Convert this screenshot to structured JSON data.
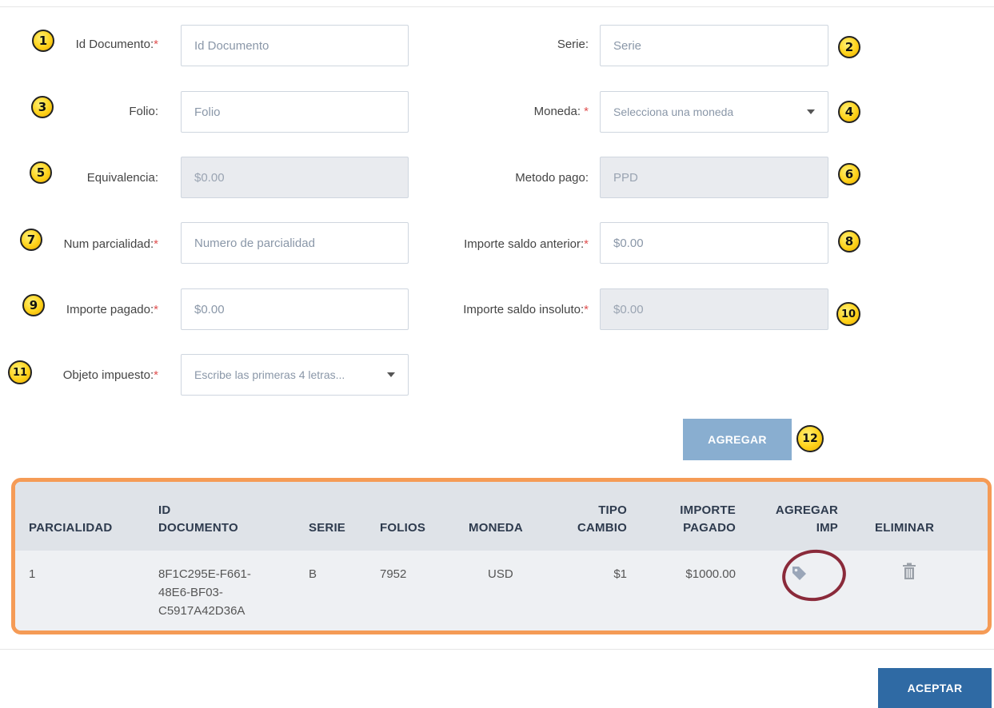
{
  "form": {
    "rows": [
      {
        "left": {
          "badge": "1",
          "label": "Id Documento:",
          "required": "*",
          "value": "",
          "placeholder": "Id Documento"
        },
        "right": {
          "badge": "2",
          "label": "Serie:",
          "required": "",
          "value": "",
          "placeholder": "Serie"
        }
      },
      {
        "left": {
          "badge": "3",
          "label": "Folio:",
          "required": "",
          "value": "",
          "placeholder": "Folio"
        },
        "right": {
          "badge": "4",
          "label": "Moneda:",
          "required": "*",
          "value": "Selecciona una moneda",
          "placeholder": ""
        }
      },
      {
        "left": {
          "badge": "5",
          "label": "Equivalencia:",
          "required": "",
          "value": "$0.00",
          "placeholder": ""
        },
        "right": {
          "badge": "6",
          "label": "Metodo pago:",
          "required": "",
          "value": "PPD",
          "placeholder": ""
        }
      },
      {
        "left": {
          "badge": "7",
          "label": "Num parcialidad:",
          "required": "*",
          "value": "",
          "placeholder": "Numero de parcialidad"
        },
        "right": {
          "badge": "8",
          "label": "Importe saldo anterior:",
          "required": "*",
          "value": "",
          "placeholder": "$0.00"
        }
      },
      {
        "left": {
          "badge": "9",
          "label": "Importe pagado:",
          "required": "*",
          "value": "",
          "placeholder": "$0.00"
        },
        "right": {
          "badge": "10",
          "label": "Importe saldo insoluto:",
          "required": "*",
          "value": "$0.00",
          "placeholder": ""
        }
      },
      {
        "left": {
          "badge": "11",
          "label": "Objeto impuesto:",
          "required": "*",
          "value": "Escribe las primeras 4 letras...",
          "placeholder": ""
        }
      }
    ]
  },
  "agregar": {
    "label": "AGREGAR",
    "badge": "12"
  },
  "table": {
    "headers": {
      "parcialidad": "PARCIALIDAD",
      "id_documento_1": "ID",
      "id_documento_2": "DOCUMENTO",
      "serie": "SERIE",
      "folios": "FOLIOS",
      "moneda": "MONEDA",
      "tipo_cambio_1": "TIPO",
      "tipo_cambio_2": "CAMBIO",
      "importe_pagado_1": "IMPORTE",
      "importe_pagado_2": "PAGADO",
      "agregar_imp_1": "AGREGAR",
      "agregar_imp_2": "IMP",
      "eliminar": "ELIMINAR"
    },
    "rows": [
      {
        "parcialidad": "1",
        "id_documento_lines": [
          "8F1C295E-F661-",
          "48E6-BF03-",
          "C5917A42D36A"
        ],
        "serie": "B",
        "folios": "7952",
        "moneda": "USD",
        "tipo_cambio": "$1",
        "importe_pagado": "$1000.00",
        "agregar_imp_icon": "tag-icon",
        "eliminar_icon": "trash-icon"
      }
    ]
  },
  "footer": {
    "aceptar_label": "ACEPTAR"
  },
  "colors": {
    "primary_button": "#2f6aa4",
    "secondary_button": "#89aed0",
    "table_highlight": "#f59b56",
    "annotation_circle": "#8a2a3a",
    "badge": "#ffd21a"
  }
}
